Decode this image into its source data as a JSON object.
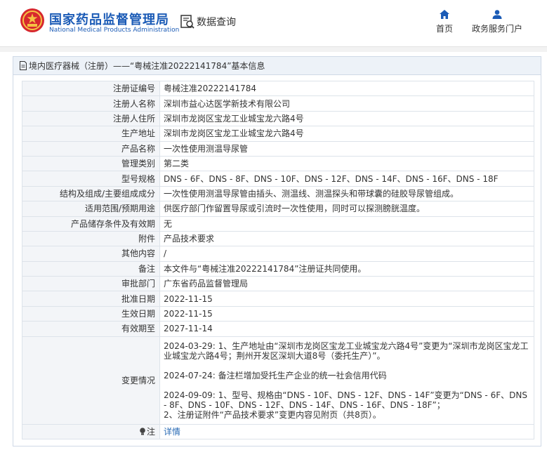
{
  "header": {
    "org_name": "国家药品监督管理局",
    "org_name_en": "National Medical Products Administration",
    "query_label": "数据查询",
    "nav": [
      {
        "label": "首页",
        "icon": "home-icon"
      },
      {
        "label": "政务服务门户",
        "icon": "user-icon"
      }
    ]
  },
  "panel": {
    "title": "境内医疗器械（注册）——“粤械注准20222141784”基本信息"
  },
  "record": {
    "rows": [
      {
        "label": "注册证编号",
        "value": "粤械注准20222141784"
      },
      {
        "label": "注册人名称",
        "value": "深圳市益心达医学新技术有限公司"
      },
      {
        "label": "注册人住所",
        "value": "深圳市龙岗区宝龙工业城宝龙六路4号"
      },
      {
        "label": "生产地址",
        "value": "深圳市龙岗区宝龙工业城宝龙六路4号"
      },
      {
        "label": "产品名称",
        "value": "一次性使用测温导尿管"
      },
      {
        "label": "管理类别",
        "value": "第二类"
      },
      {
        "label": "型号规格",
        "value": "DNS - 6F、DNS - 8F、DNS - 10F、DNS - 12F、DNS - 14F、DNS - 16F、DNS - 18F"
      },
      {
        "label": "结构及组成/主要组成成分",
        "value": "一次性使用测温导尿管由插头、测温线、测温探头和带球囊的硅胶导尿管组成。"
      },
      {
        "label": "适用范围/预期用途",
        "value": "供医疗部门作留置导尿或引流时一次性使用，同时可以探测膀胱温度。"
      },
      {
        "label": "产品储存条件及有效期",
        "value": "无"
      },
      {
        "label": "附件",
        "value": "产品技术要求"
      },
      {
        "label": "其他内容",
        "value": "/"
      },
      {
        "label": "备注",
        "value": "本文件与“粤械注准20222141784”注册证共同使用。"
      },
      {
        "label": "审批部门",
        "value": "广东省药品监督管理局"
      },
      {
        "label": "批准日期",
        "value": "2022-11-15"
      },
      {
        "label": "生效日期",
        "value": "2022-11-15"
      },
      {
        "label": "有效期至",
        "value": "2027-11-14"
      }
    ],
    "change_label": "变更情况",
    "changes": [
      "2024-03-29: 1、生产地址由“深圳市龙岗区宝龙工业城宝龙六路4号”变更为“深圳市龙岗区宝龙工业城宝龙六路4号；荆州开发区深圳大道8号（委托生产）”。",
      "2024-07-24: 备注栏增加受托生产企业的统一社会信用代码",
      "2024-09-09: 1、型号、规格由“DNS - 10F、DNS - 12F、DNS - 14F”变更为“DNS - 6F、DNS - 8F、DNS - 10F、DNS - 12F、DNS - 14F、DNS - 16F、DNS - 18F”；\n2、注册证附件“产品技术要求”变更内容见附页（共8页）。"
    ],
    "note_label": "注",
    "note_value": "详情"
  },
  "colors": {
    "brand_blue": "#1b5bb6",
    "link_blue": "#2a6bb5",
    "label_bg": "#f3f5f8",
    "title_bg": "#edf2f8"
  }
}
